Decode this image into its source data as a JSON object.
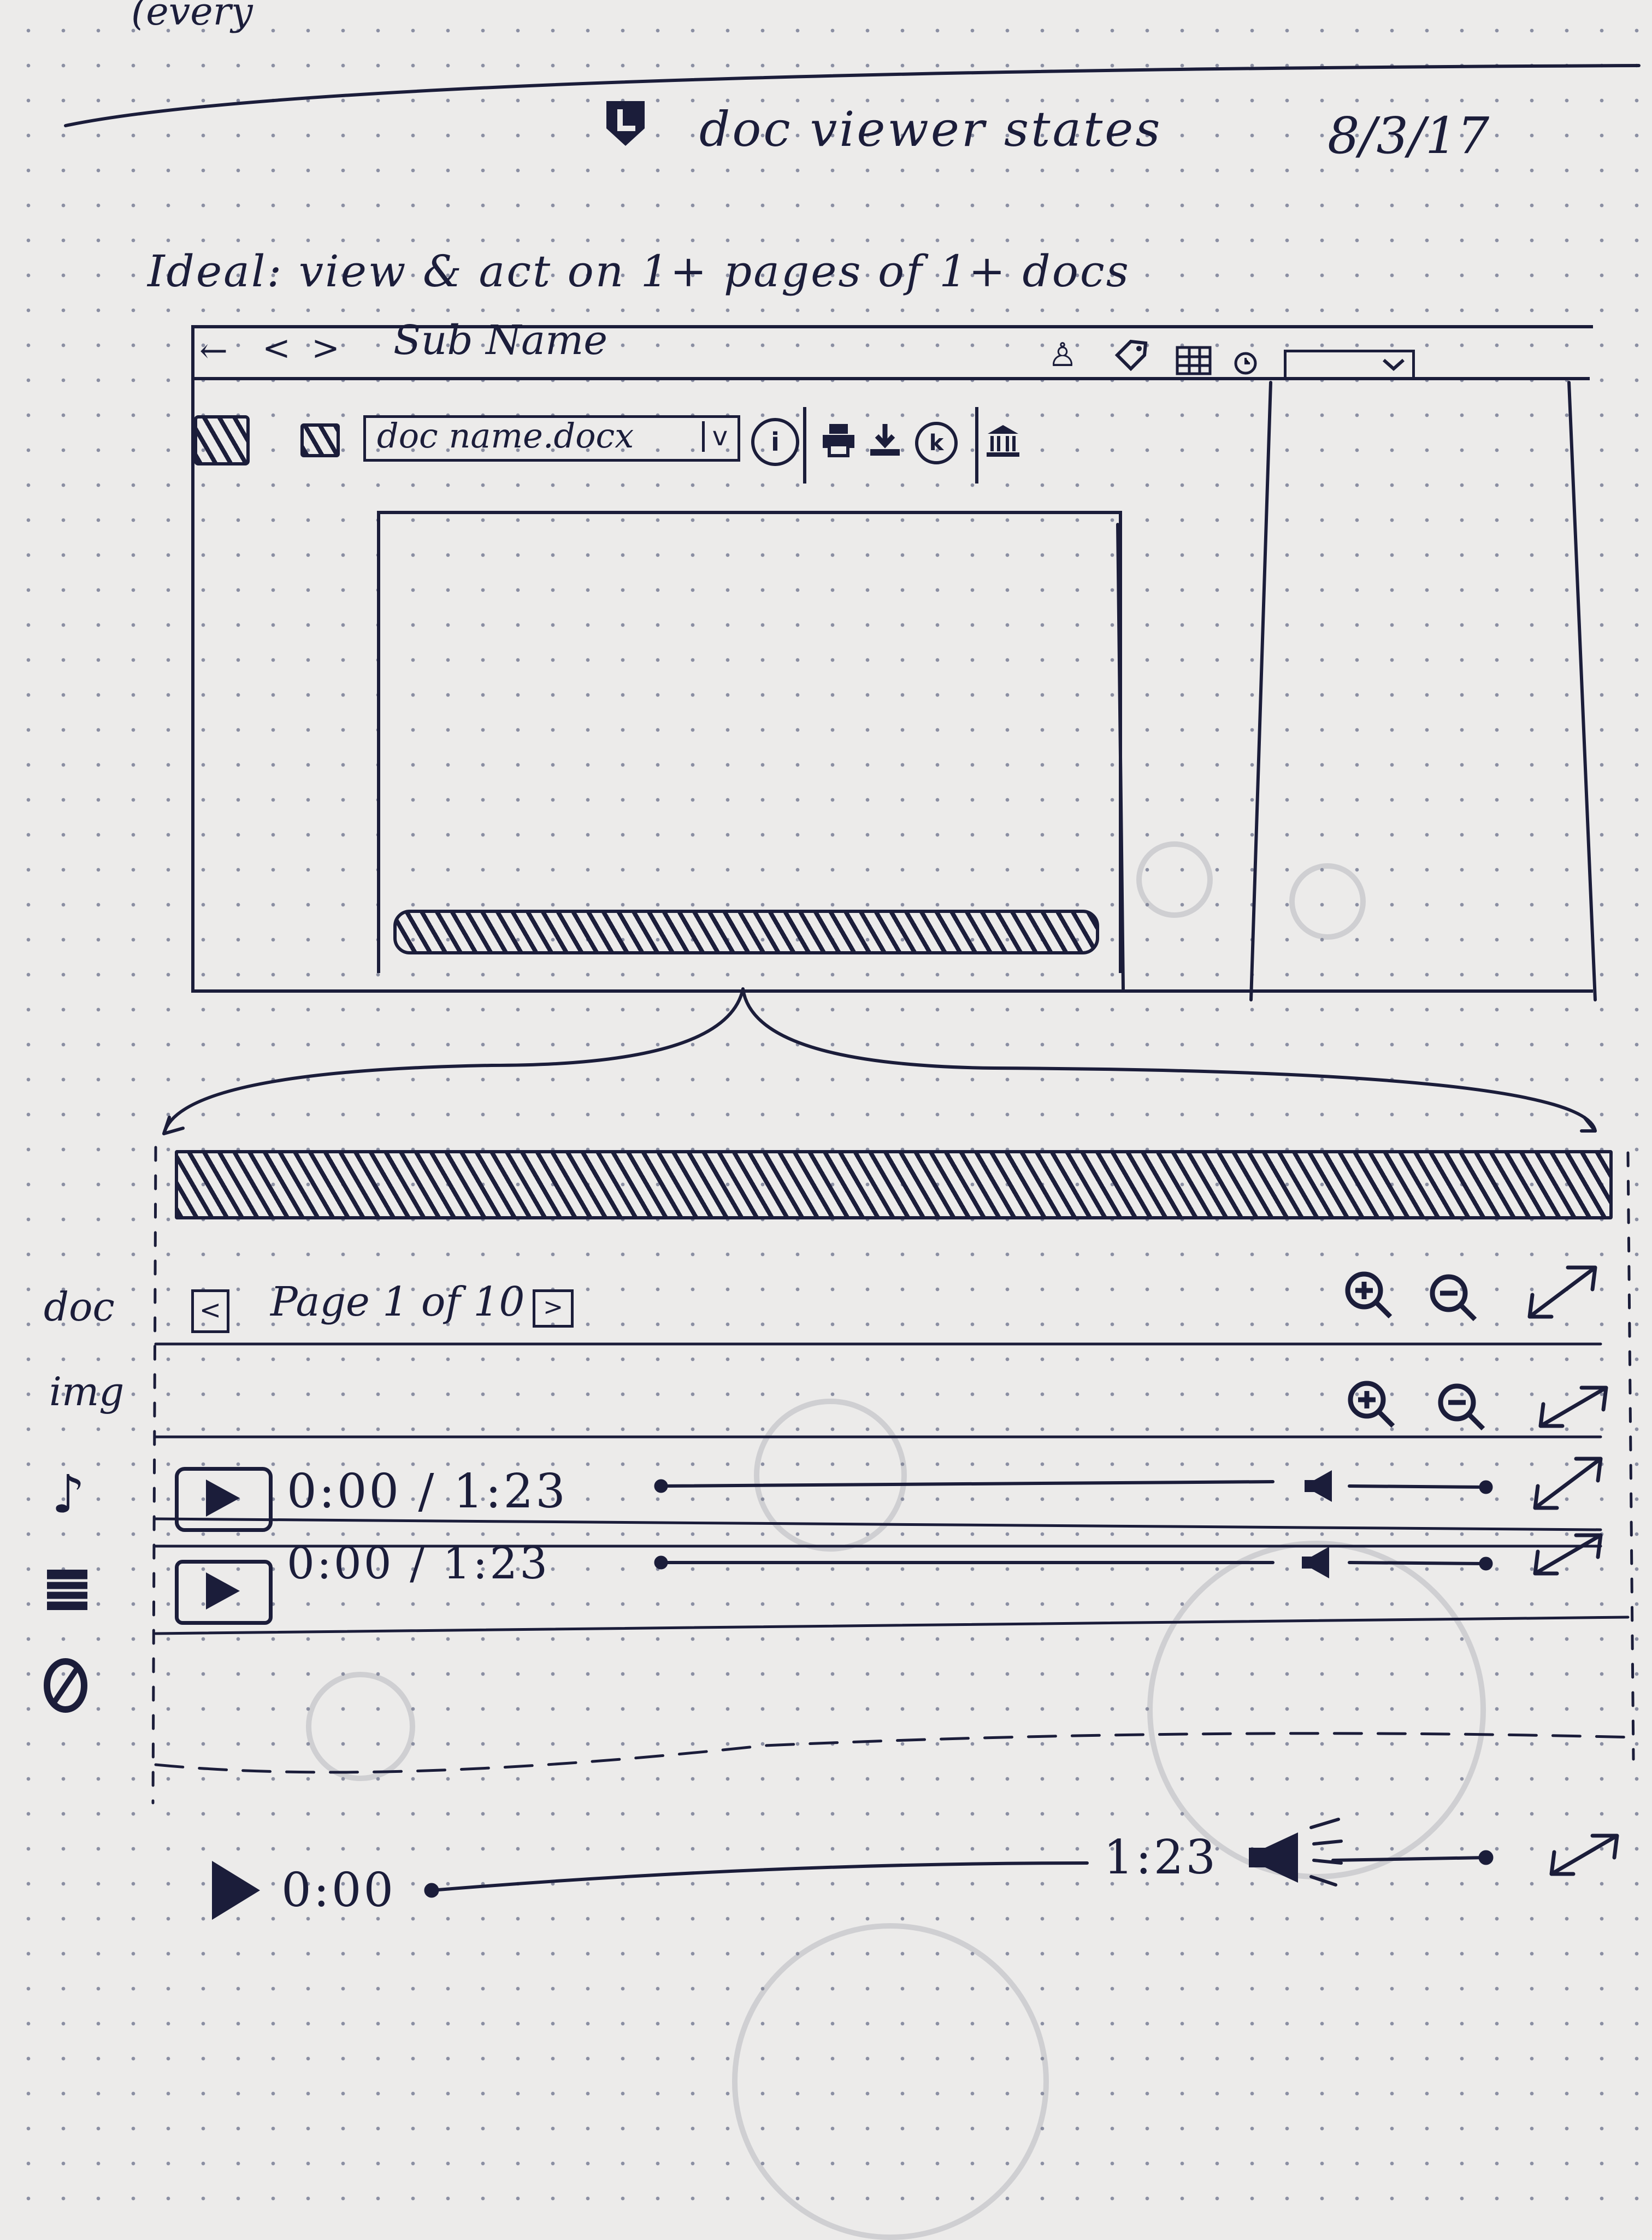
{
  "page": {
    "top_scribble": "(every",
    "title": "doc viewer states",
    "date": "8/3/17",
    "ideal": "Ideal: view & act on 1+ pages of 1+ docs"
  },
  "browser": {
    "back": "←",
    "nav_prev": "<",
    "nav_next": ">",
    "title": "Sub Name"
  },
  "toolbar": {
    "doc_name": "doc name.docx",
    "dropdown_mark": "v",
    "info_icon": "i",
    "k_icon": "k"
  },
  "states": {
    "doc": {
      "label": "doc",
      "page_text": "Page 1 of 10",
      "prev": "<",
      "next": ">"
    },
    "img": {
      "label": "img"
    },
    "audio": {
      "time": "0:00 / 1:23"
    },
    "video": {
      "time": "0:00 / 1:23"
    }
  },
  "player": {
    "current": "0:00",
    "duration": "1:23"
  }
}
